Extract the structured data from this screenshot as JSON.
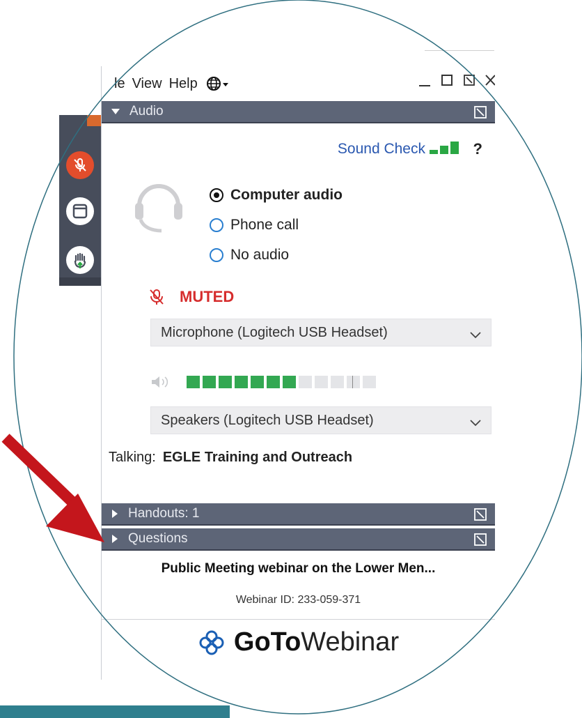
{
  "window": {
    "menu": [
      "le",
      "View",
      "Help"
    ],
    "language_icon": "globe-icon",
    "controls": [
      "minimize-icon",
      "maximize-icon",
      "restore-icon",
      "close-icon"
    ]
  },
  "sidebar": {
    "items": [
      "microphone-muted-icon",
      "window-icon",
      "raise-hand-icon"
    ]
  },
  "audio": {
    "header": "Audio",
    "sound_check": "Sound Check",
    "help": "?",
    "options": [
      {
        "label": "Computer audio",
        "selected": true
      },
      {
        "label": "Phone call",
        "selected": false
      },
      {
        "label": "No audio",
        "selected": false
      }
    ],
    "status": "MUTED",
    "microphone": "Microphone (Logitech USB Headset)",
    "speaker_level_fraction": 0.58,
    "speakers": "Speakers (Logitech USB Headset)",
    "talking_label": "Talking:",
    "talking_name": "EGLE Training and Outreach"
  },
  "sections": {
    "handouts": "Handouts: 1",
    "questions": "Questions"
  },
  "webinar": {
    "title": "Public Meeting webinar on the Lower Men...",
    "id": "Webinar ID: 233-059-371"
  },
  "brand": {
    "go": "GoTo",
    "webinar": "Webinar"
  },
  "colors": {
    "header_bg": "#5d6577",
    "accent_blue": "#2a58b0",
    "muted_red": "#d62d2d",
    "level_green": "#33a852",
    "arrow_red": "#c4161c",
    "frame_teal": "#2f7f8e"
  }
}
